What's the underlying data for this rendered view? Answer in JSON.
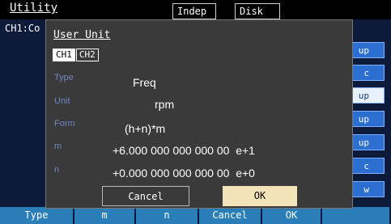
{
  "topbar": {
    "menu": "Utility",
    "tabs": [
      "Indep",
      "Disk"
    ]
  },
  "background": {
    "line": "CH1:Co"
  },
  "side_buttons": [
    "up",
    "c",
    "up",
    "up",
    "up",
    "c",
    "w"
  ],
  "dialog": {
    "title": "User Unit",
    "channels": [
      "CH1",
      "CH2"
    ],
    "rows": [
      {
        "label": "Type",
        "value": "Freq"
      },
      {
        "label": "Unit",
        "value": "rpm"
      },
      {
        "label": "Form",
        "value": "(h+n)*m"
      },
      {
        "label": "m",
        "value": "+6.000 000 000 000 00  e+1"
      },
      {
        "label": "n",
        "value": "+0.000 000 000 000 00  e+0"
      }
    ],
    "cancel": "Cancel",
    "ok": "OK"
  },
  "softkeys": [
    "Type",
    "m",
    "n",
    "Cancel",
    "OK"
  ],
  "colors": {
    "accent": "#2a7fb8",
    "dialog_bg": "#3a3a3a",
    "ok_bg": "#f3e3b8"
  }
}
